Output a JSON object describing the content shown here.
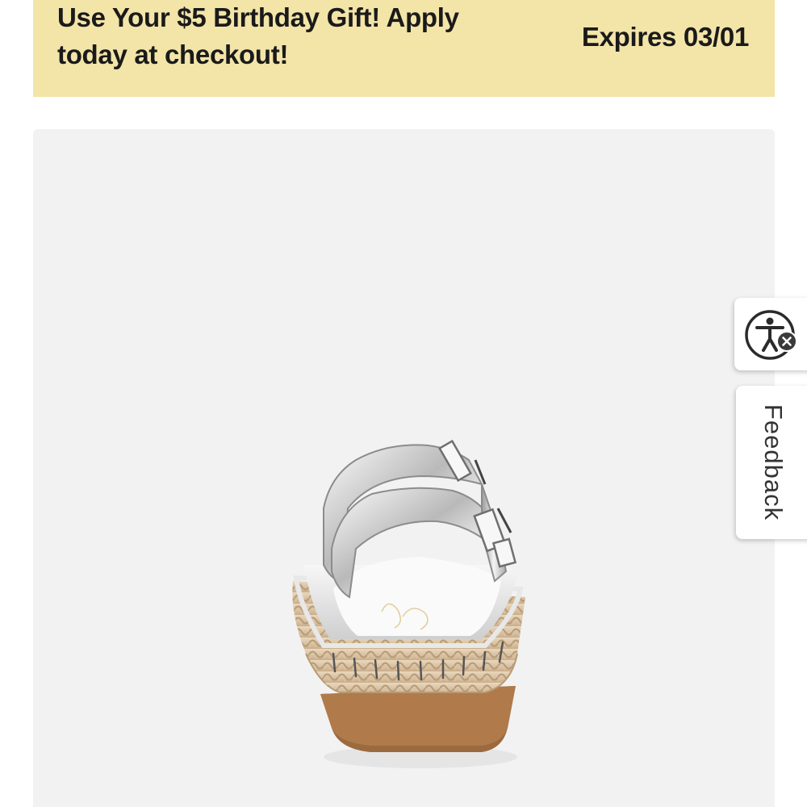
{
  "promo_banner": {
    "message": "Use Your $5 Birthday Gift! Apply today at checkout!",
    "expiry": "Expires 03/01",
    "background_color": "#f3e4a8"
  },
  "product": {
    "image_icon": "sandal-product-photo",
    "image_background_color": "#f2f2f2"
  },
  "accessibility_widget": {
    "icon": "accessibility-person-icon",
    "badge_icon": "close-icon"
  },
  "feedback_tab": {
    "label": "Feedback"
  }
}
